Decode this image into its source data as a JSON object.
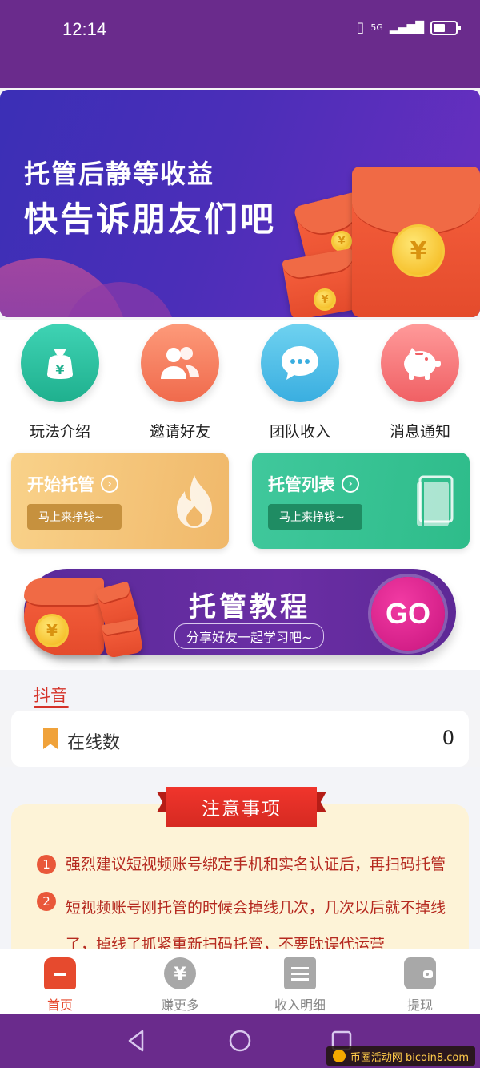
{
  "status_bar": {
    "time": "12:14",
    "network": "5G"
  },
  "banner": {
    "line1": "托管后静等收益",
    "line2": "快告诉朋友们吧",
    "coin_symbol": "¥"
  },
  "quick_icons": [
    {
      "label": "玩法介绍",
      "icon": "money-bag-icon",
      "color_from": "#3fd3b4",
      "color_to": "#1fb08e",
      "glyph": "¥"
    },
    {
      "label": "邀请好友",
      "icon": "people-icon",
      "color_from": "#fd9a7a",
      "color_to": "#f06a4c",
      "glyph": "👥"
    },
    {
      "label": "团队收入",
      "icon": "chat-bubble-icon",
      "color_from": "#6fd2f0",
      "color_to": "#3aaee0",
      "glyph": "💬"
    },
    {
      "label": "消息通知",
      "icon": "piggy-bank-icon",
      "color_from": "#ff9a9a",
      "color_to": "#f06064",
      "glyph": "🐷"
    }
  ],
  "cards": {
    "start": {
      "title": "开始托管",
      "pill": "马上来挣钱~"
    },
    "list": {
      "title": "托管列表",
      "pill": "马上来挣钱~"
    }
  },
  "tutorial": {
    "title": "托管教程",
    "subtitle": "分享好友一起学习吧~",
    "go_label": "GO",
    "coin_symbol": "¥"
  },
  "tabs": {
    "active": "抖音"
  },
  "online": {
    "label": "在线数",
    "value": "0"
  },
  "notes": {
    "heading": "注意事项",
    "items": [
      {
        "num": "1",
        "text": "强烈建议短视频账号绑定手机和实名认证后，再扫码托管"
      },
      {
        "num": "2",
        "text": "短视频账号刚托管的时候会掉线几次，几次以后就不掉线了，掉线了抓紧重新扫码托管，不要耽误代运营"
      }
    ]
  },
  "bottom_nav": [
    {
      "label": "首页",
      "active": true
    },
    {
      "label": "赚更多",
      "active": false
    },
    {
      "label": "收入明细",
      "active": false
    },
    {
      "label": "提现",
      "active": false
    }
  ],
  "watermark": {
    "text": "币圈活动网  bicoin8.com"
  },
  "colors": {
    "primary_purple": "#6a2b8c",
    "accent_red": "#e64a2e",
    "note_text": "#b5291f"
  }
}
